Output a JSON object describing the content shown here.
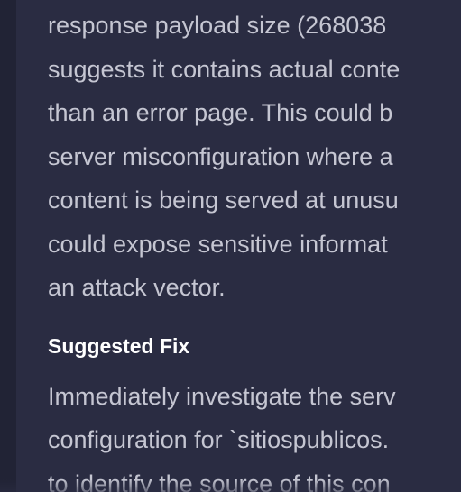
{
  "finding": {
    "description_lines": [
      "response payload size (268038",
      "suggests it contains actual conte",
      "than an error page. This could b",
      "server misconfiguration where a",
      "content is being served at unusu",
      "could expose sensitive informat",
      "an attack vector."
    ],
    "fix_heading": "Suggested Fix",
    "fix_lines": [
      "Immediately investigate the serv",
      "configuration for `sitiospublicos.",
      "to identify the source of this con"
    ]
  },
  "colors": {
    "background": "#2a2c42",
    "body_text": "#c5c6d2",
    "heading_text": "#ffffff"
  }
}
